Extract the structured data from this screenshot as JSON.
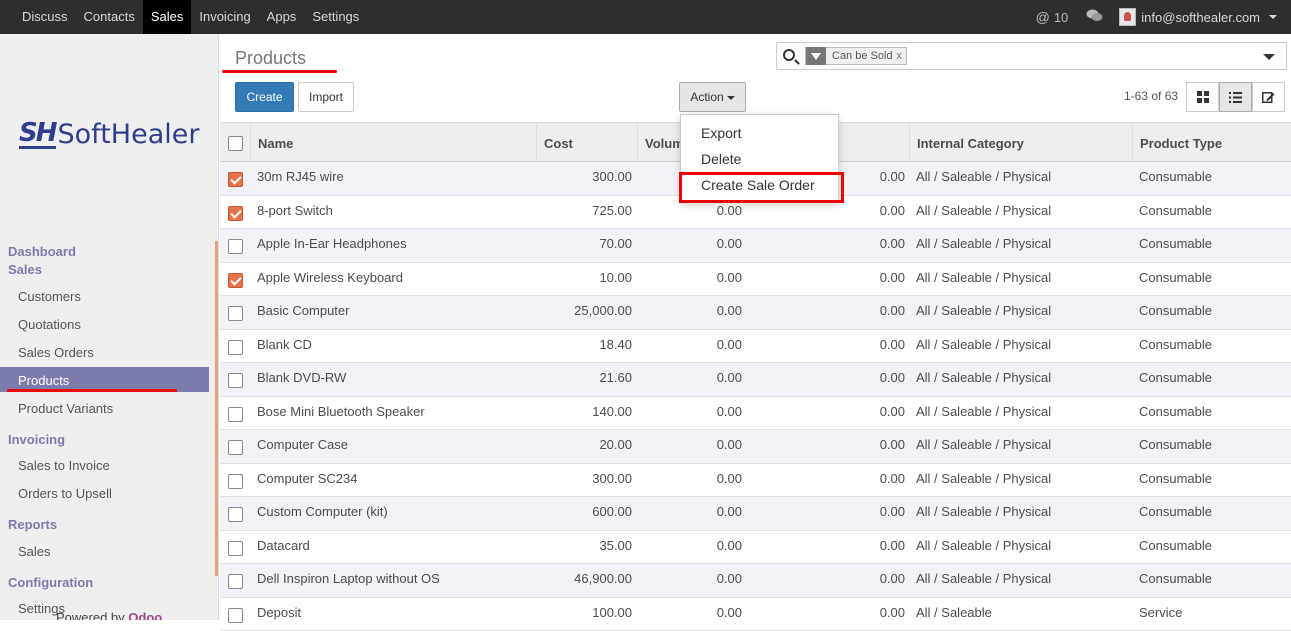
{
  "topbar": {
    "nav": [
      {
        "label": "Discuss",
        "active": false
      },
      {
        "label": "Contacts",
        "active": false
      },
      {
        "label": "Sales",
        "active": true
      },
      {
        "label": "Invoicing",
        "active": false
      },
      {
        "label": "Apps",
        "active": false
      },
      {
        "label": "Settings",
        "active": false
      }
    ],
    "mentions_count": "10",
    "user_email": "info@softhealer.com"
  },
  "sidebar": {
    "logo": {
      "mark": "SH",
      "text": "SoftHealer"
    },
    "sections": [
      {
        "label": "Dashboard"
      },
      {
        "label": "Sales"
      },
      {
        "label": "Invoicing"
      },
      {
        "label": "Reports"
      },
      {
        "label": "Configuration"
      }
    ],
    "items": [
      {
        "label": "Customers"
      },
      {
        "label": "Quotations"
      },
      {
        "label": "Sales Orders"
      },
      {
        "label": "Products",
        "active": true
      },
      {
        "label": "Product Variants"
      },
      {
        "label": "Sales to Invoice"
      },
      {
        "label": "Orders to Upsell"
      },
      {
        "label": "Sales"
      },
      {
        "label": "Settings"
      }
    ],
    "powered_by": "Powered by",
    "powered_brand": "Odoo"
  },
  "main": {
    "title": "Products",
    "search": {
      "facet": "Can be Sold",
      "facet_remove": "x"
    },
    "buttons": {
      "create": "Create",
      "import": "Import",
      "action": "Action"
    },
    "pager": "1-63 of 63",
    "action_menu": [
      "Export",
      "Delete",
      "Create Sale Order"
    ],
    "columns": [
      "Name",
      "Cost",
      "Volume",
      "Internal Category",
      "Product Type"
    ],
    "rows": [
      {
        "checked": true,
        "name": "30m RJ45 wire",
        "cost": "300.00",
        "volume": "0.00",
        "weight": "0.00",
        "category": "All / Saleable / Physical",
        "type": "Consumable"
      },
      {
        "checked": true,
        "name": "8-port Switch",
        "cost": "725.00",
        "volume": "0.00",
        "weight": "0.00",
        "category": "All / Saleable / Physical",
        "type": "Consumable"
      },
      {
        "checked": false,
        "name": "Apple In-Ear Headphones",
        "cost": "70.00",
        "volume": "0.00",
        "weight": "0.00",
        "category": "All / Saleable / Physical",
        "type": "Consumable"
      },
      {
        "checked": true,
        "name": "Apple Wireless Keyboard",
        "cost": "10.00",
        "volume": "0.00",
        "weight": "0.00",
        "category": "All / Saleable / Physical",
        "type": "Consumable"
      },
      {
        "checked": false,
        "name": "Basic Computer",
        "cost": "25,000.00",
        "volume": "0.00",
        "weight": "0.00",
        "category": "All / Saleable / Physical",
        "type": "Consumable"
      },
      {
        "checked": false,
        "name": "Blank CD",
        "cost": "18.40",
        "volume": "0.00",
        "weight": "0.00",
        "category": "All / Saleable / Physical",
        "type": "Consumable"
      },
      {
        "checked": false,
        "name": "Blank DVD-RW",
        "cost": "21.60",
        "volume": "0.00",
        "weight": "0.00",
        "category": "All / Saleable / Physical",
        "type": "Consumable"
      },
      {
        "checked": false,
        "name": "Bose Mini Bluetooth Speaker",
        "cost": "140.00",
        "volume": "0.00",
        "weight": "0.00",
        "category": "All / Saleable / Physical",
        "type": "Consumable"
      },
      {
        "checked": false,
        "name": "Computer Case",
        "cost": "20.00",
        "volume": "0.00",
        "weight": "0.00",
        "category": "All / Saleable / Physical",
        "type": "Consumable"
      },
      {
        "checked": false,
        "name": "Computer SC234",
        "cost": "300.00",
        "volume": "0.00",
        "weight": "0.00",
        "category": "All / Saleable / Physical",
        "type": "Consumable"
      },
      {
        "checked": false,
        "name": "Custom Computer (kit)",
        "cost": "600.00",
        "volume": "0.00",
        "weight": "0.00",
        "category": "All / Saleable / Physical",
        "type": "Consumable"
      },
      {
        "checked": false,
        "name": "Datacard",
        "cost": "35.00",
        "volume": "0.00",
        "weight": "0.00",
        "category": "All / Saleable / Physical",
        "type": "Consumable"
      },
      {
        "checked": false,
        "name": "Dell Inspiron Laptop without OS",
        "cost": "46,900.00",
        "volume": "0.00",
        "weight": "0.00",
        "category": "All / Saleable / Physical",
        "type": "Consumable"
      },
      {
        "checked": false,
        "name": "Deposit",
        "cost": "100.00",
        "volume": "0.00",
        "weight": "0.00",
        "category": "All / Saleable",
        "type": "Service"
      }
    ]
  },
  "colors": {
    "topbar": "#2e2e2e",
    "sidebar_accent": "#7c7bad",
    "primary_button": "#337ab7",
    "checkbox_checked": "#e8734a",
    "highlight": "#ee0000"
  }
}
